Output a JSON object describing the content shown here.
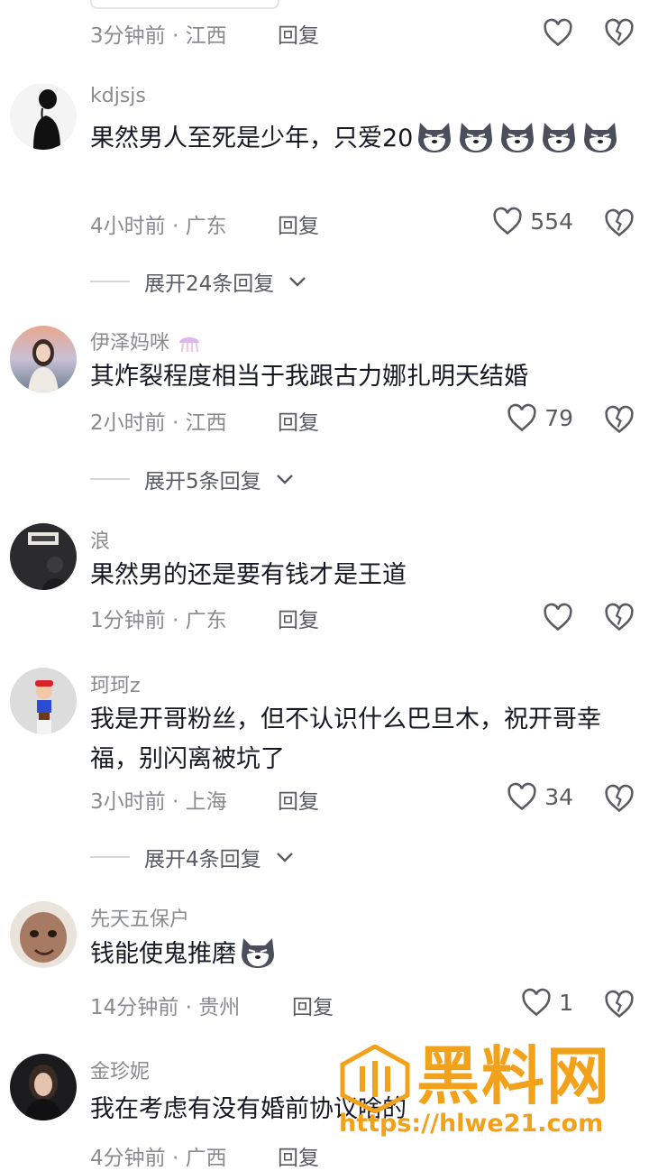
{
  "comments": [
    {
      "meta_time": "3分钟前",
      "meta_loc": "江西",
      "reply_label": "回复"
    },
    {
      "username": "kdjsjs",
      "text": "果然男人至死是少年，只爱20",
      "meta_time": "4小时前",
      "meta_loc": "广东",
      "reply_label": "回复",
      "likes": "554",
      "expand_label": "展开24条回复",
      "emoji_icons": [
        "wolf-emoji-icon",
        "wolf-emoji-icon",
        "wolf-emoji-icon",
        "wolf-emoji-icon",
        "wolf-emoji-icon"
      ]
    },
    {
      "username": "伊泽妈咪",
      "text": "其炸裂程度相当于我跟古力娜扎明天结婚",
      "meta_time": "2小时前",
      "meta_loc": "江西",
      "reply_label": "回复",
      "likes": "79",
      "expand_label": "展开5条回复"
    },
    {
      "username": "浪",
      "text": "果然男的还是要有钱才是王道",
      "meta_time": "1分钟前",
      "meta_loc": "广东",
      "reply_label": "回复"
    },
    {
      "username": "珂珂z",
      "text": "我是开哥粉丝，但不认识什么巴旦木，祝开哥幸福，别闪离被坑了",
      "meta_time": "3小时前",
      "meta_loc": "上海",
      "reply_label": "回复",
      "likes": "34",
      "expand_label": "展开4条回复"
    },
    {
      "username": "先天五保户",
      "text": "钱能使鬼推磨",
      "meta_time": "14分钟前",
      "meta_loc": "贵州",
      "reply_label": "回复",
      "likes": "1"
    },
    {
      "username": "金珍妮",
      "text": "我在考虑有没有婚前协议啥的",
      "meta_time": "4分钟前",
      "meta_loc": "广西",
      "reply_label": "回复"
    }
  ],
  "separator": "·",
  "watermark": {
    "title": "黑料网",
    "url": "https://hlwe21.com"
  },
  "colors": {
    "text": "#161823",
    "secondary": "#8a8b91",
    "watermark": "#f2a11a"
  }
}
